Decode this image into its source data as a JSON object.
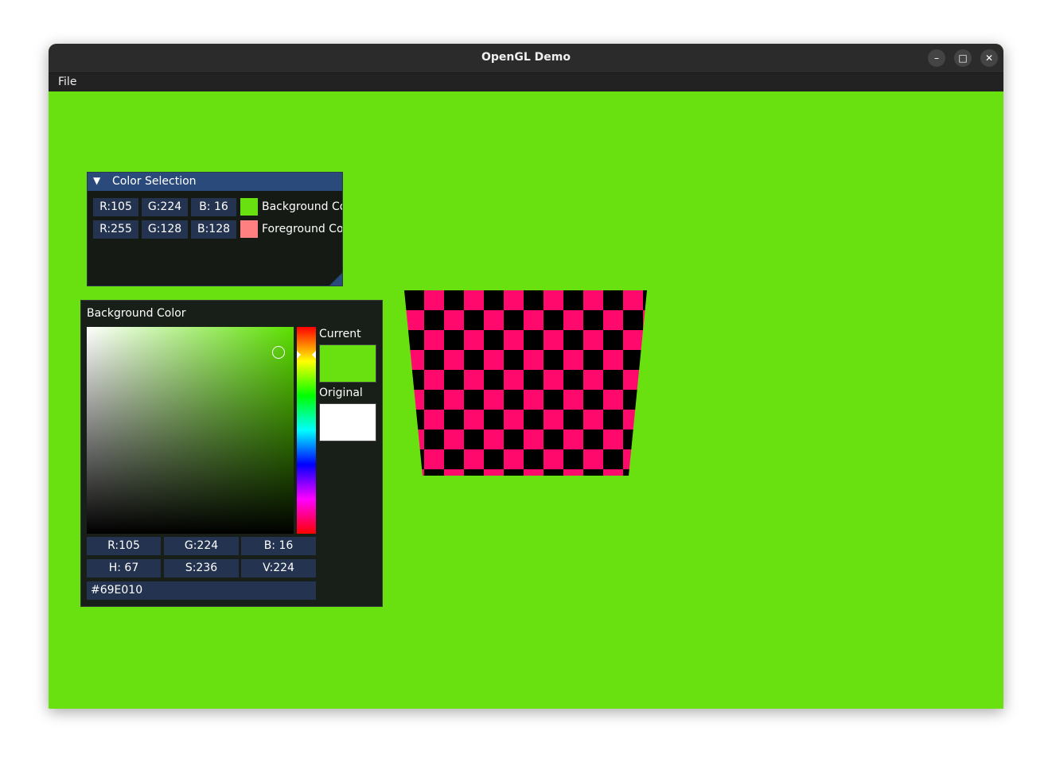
{
  "window": {
    "title": "OpenGL Demo",
    "minimize_icon": "minimize-icon",
    "maximize_icon": "maximize-icon",
    "close_icon": "close-icon",
    "background_color": "#69E010"
  },
  "menubar": {
    "items": [
      {
        "label": "File"
      }
    ]
  },
  "color_selection": {
    "title": "Color Selection",
    "collapse_icon": "triangle-down-icon",
    "rows": [
      {
        "r": "R:105",
        "g": "G:224",
        "b": "B: 16",
        "swatch": "#69E010",
        "label": "Background Color"
      },
      {
        "r": "R:255",
        "g": "G:128",
        "b": "B:128",
        "swatch": "#FF8080",
        "label": "Foreground Color"
      }
    ]
  },
  "picker": {
    "title": "Background Color",
    "current_label": "Current",
    "original_label": "Original",
    "current_color": "#69E010",
    "original_color": "#FFFFFF",
    "rgb": {
      "r": "R:105",
      "g": "G:224",
      "b": "B: 16"
    },
    "hsv": {
      "h": "H: 67",
      "s": "S:236",
      "v": "V:224"
    },
    "hex": "#69E010"
  },
  "checkerboard": {
    "color_a": "#FF0A6C",
    "color_b": "#000000",
    "columns": 11,
    "rows": 9
  }
}
